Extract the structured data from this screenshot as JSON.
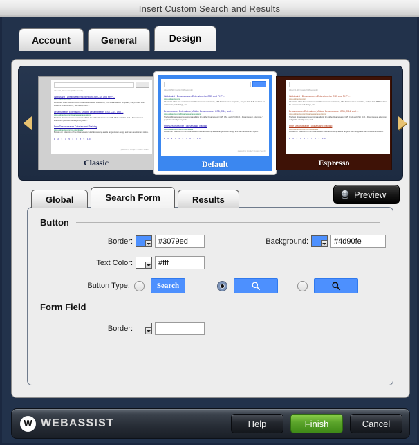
{
  "window": {
    "title": "Insert Custom Search and Results"
  },
  "outer_tabs": [
    {
      "label": "Account",
      "active": false
    },
    {
      "label": "General",
      "active": false
    },
    {
      "label": "Design",
      "active": true
    }
  ],
  "carousel": {
    "left_arrow": "prev-theme-arrow",
    "right_arrow": "next-theme-arrow",
    "themes": [
      {
        "name": "Classic",
        "selected": false
      },
      {
        "name": "Default",
        "selected": true
      },
      {
        "name": "Espresso",
        "selected": false
      }
    ],
    "mock": {
      "result1_title": "WebAssist : Dreamweaver Extensions for CSS and PHP ...",
      "result1_url": "www.webassist.com/",
      "result1_snip": "WebAssist offers free and commercial Dreamweaver extensions, CSS Dreamweaver templates, and pre-built PHP solutions for ecommerce, web design, and ...",
      "result2_title": "Dreamweaver Extensions | Adobe Dreamweaver CS5, CS4, and ...",
      "result2_url": "www.webassist.com/Dreamweaver-extensions/",
      "result2_snip": "The best Dreamweaver extensions available for Adobe Dreamweaver CS5, CS4, and CS3. Find a Dreamweaver extension / plugin for virtually every web ...",
      "result3_title": "Free Dreamweaver Tutorials and Training",
      "result3_url": "www.webassist.com/free-downloads/",
      "result3_snip": "Browse our collection of free Dreamweaver tutorials covering a wide range of web design and web development topics.",
      "count": "About 61,500 results (0.36 seconds)",
      "pages": "1 2 3 4 5 6 7 8 9 10",
      "powered": "powered by Google™ Custom Search"
    }
  },
  "inner_tabs": [
    {
      "label": "Global",
      "active": false
    },
    {
      "label": "Search Form",
      "active": true
    },
    {
      "label": "Results",
      "active": false
    }
  ],
  "preview_button": {
    "label": "Preview",
    "icon": "globe-icon"
  },
  "button_section": {
    "legend": "Button",
    "border_label": "Border:",
    "border_value": "#3079ed",
    "background_label": "Background:",
    "background_value": "#4d90fe",
    "text_color_label": "Text Color:",
    "text_color_value": "#fff",
    "button_type_label": "Button Type:",
    "options": [
      {
        "kind": "text",
        "label": "Search",
        "selected": false
      },
      {
        "kind": "icon-white",
        "label": "",
        "selected": true
      },
      {
        "kind": "icon-black",
        "label": "",
        "selected": false
      }
    ]
  },
  "form_field_section": {
    "legend": "Form Field",
    "border_label": "Border:",
    "border_value": ""
  },
  "footer": {
    "brand": "WEBASSIST",
    "brand_mark": "W",
    "help_label": "Help",
    "finish_label": "Finish",
    "cancel_label": "Cancel"
  },
  "colors": {
    "accent_blue": "#4d90fe",
    "border_blue": "#3079ed",
    "finish_green": "#5aa32a",
    "chrome_navy": "#22324b"
  }
}
